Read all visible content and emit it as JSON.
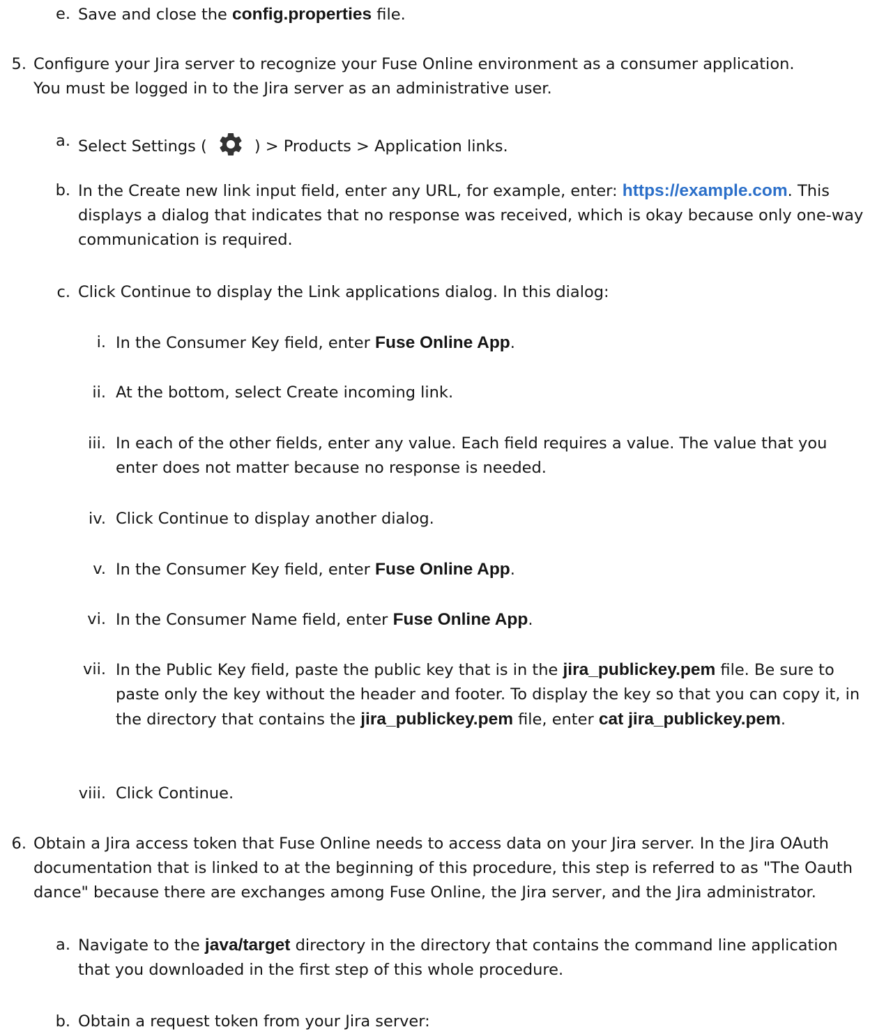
{
  "step4e": {
    "num": "e.",
    "t1": "Save and close the ",
    "file": "config.properties",
    "t2": " file."
  },
  "step5": {
    "num": "5.",
    "text": "Configure your Jira server to recognize your Fuse Online environment as a consumer application. You must be logged in to the Jira server as an administrative user."
  },
  "step5a": {
    "num": "a.",
    "t1": "Select ",
    "settings": "Settings",
    "t2": " (",
    "t3": ") > ",
    "products": "Products",
    "t4": " > ",
    "applinks": "Application links",
    "t5": ".",
    "icon": "gear-icon"
  },
  "step5b": {
    "num": "b.",
    "t1": "In the ",
    "field": "Create new link",
    "t2": " input field, enter any URL, for example, enter: ",
    "url": "https://example.com",
    "t3": ". This displays a dialog that indicates that no response was received, which is okay because only one-way communication is required."
  },
  "step5c": {
    "num": "c.",
    "t1": "Click ",
    "btn": "Continue",
    "t2": " to display the ",
    "dialog": "Link applications",
    "t3": " dialog. In this dialog:"
  },
  "step5c_i": {
    "num": "i.",
    "t1": "In the ",
    "field": "Consumer Key",
    "t2": " field, enter ",
    "value": "Fuse Online App",
    "t3": "."
  },
  "step5c_ii": {
    "num": "ii.",
    "t1": "At the bottom, select ",
    "option": "Create incoming link",
    "t2": "."
  },
  "step5c_iii": {
    "num": "iii.",
    "text": "In each of the other fields, enter any value. Each field requires a value. The value that you enter does not matter because no response is needed."
  },
  "step5c_iv": {
    "num": "iv.",
    "t1": "Click ",
    "btn": "Continue",
    "t2": " to display another dialog."
  },
  "step5c_v": {
    "num": "v.",
    "t1": "In the ",
    "field": "Consumer Key",
    "t2": " field, enter ",
    "value": "Fuse Online App",
    "t3": "."
  },
  "step5c_vi": {
    "num": "vi.",
    "t1": "In the ",
    "field": "Consumer Name",
    "t2": " field, enter ",
    "value": "Fuse Online App",
    "t3": "."
  },
  "step5c_vii": {
    "num": "vii.",
    "t1": "In the ",
    "field": "Public Key",
    "t2": " field, paste the public key that is in the ",
    "file1": "jira_publickey.pem",
    "t3": " file. Be sure to paste only the key without the header and footer. To display the key so that you can copy it, in the directory that contains the ",
    "file2": "jira_publickey.pem",
    "t4": " file, enter ",
    "cmd": "cat jira_publickey.pem",
    "t5": "."
  },
  "step5c_viii": {
    "num": "viii.",
    "t1": "Click ",
    "btn": "Continue",
    "t2": "."
  },
  "step6": {
    "num": "6.",
    "text": "Obtain a Jira access token that Fuse Online needs to access data on your Jira server. In the Jira OAuth documentation that is linked to at the beginning of this procedure, this step is referred to as \"The Oauth dance\" because there are exchanges among Fuse Online, the Jira server, and the Jira administrator."
  },
  "step6a": {
    "num": "a.",
    "t1": "Navigate to the ",
    "dir": "java/target",
    "t2": " directory in the directory that contains the command line application that you downloaded in the first step of this whole procedure."
  },
  "step6b": {
    "num": "b.",
    "text": "Obtain a request token from your Jira server:"
  }
}
